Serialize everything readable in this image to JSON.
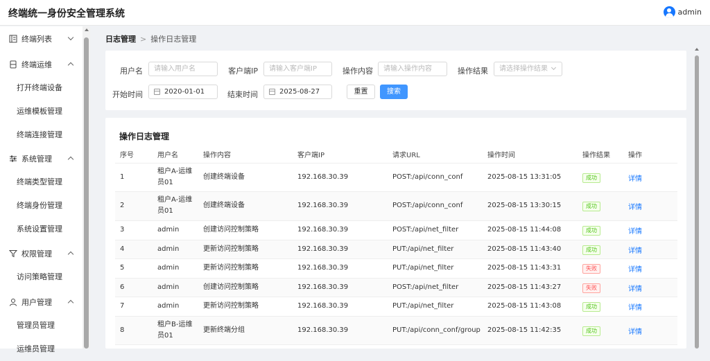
{
  "app": {
    "title": "终端统一身份安全管理系统",
    "user": "admin"
  },
  "sidebar": {
    "groups": [
      {
        "label": "终端列表",
        "icon": "list-icon",
        "expanded": false
      },
      {
        "label": "终端运维",
        "icon": "terminal-icon",
        "expanded": true,
        "items": [
          "打开终端设备",
          "运维模板管理",
          "终端连接管理"
        ]
      },
      {
        "label": "系统管理",
        "icon": "sliders-icon",
        "expanded": true,
        "items": [
          "终端类型管理",
          "终端身份管理",
          "系统设置管理"
        ]
      },
      {
        "label": "权限管理",
        "icon": "filter-icon",
        "expanded": true,
        "items": [
          "访问策略管理"
        ]
      },
      {
        "label": "用户管理",
        "icon": "user-icon",
        "expanded": true,
        "items": [
          "管理员管理",
          "运维员管理"
        ]
      }
    ]
  },
  "breadcrumb": {
    "root": "日志管理",
    "separator": ">",
    "current": "操作日志管理"
  },
  "filters": {
    "username": {
      "label": "用户名",
      "placeholder": "请输入用户名"
    },
    "client_ip": {
      "label": "客户端IP",
      "placeholder": "请输入客户端IP"
    },
    "op_content": {
      "label": "操作内容",
      "placeholder": "请输入操作内容"
    },
    "op_result": {
      "label": "操作结果",
      "placeholder": "请选择操作结果"
    },
    "start_time": {
      "label": "开始时间",
      "value": "2020-01-01"
    },
    "end_time": {
      "label": "结束时间",
      "value": "2025-08-27"
    },
    "reset_label": "重置",
    "search_label": "搜索"
  },
  "table": {
    "title": "操作日志管理",
    "columns": [
      "序号",
      "用户名",
      "操作内容",
      "客户端IP",
      "请求URL",
      "操作时间",
      "操作结果",
      "操作"
    ],
    "rows": [
      {
        "no": "1",
        "user": [
          "租户A-运维",
          "员01"
        ],
        "content": "创建终端设备",
        "ip": "192.168.30.39",
        "url": "POST:/api/conn_conf",
        "time": "2025-08-15 13:31:05",
        "result": "成功",
        "ok": true,
        "action": "详情"
      },
      {
        "no": "2",
        "user": [
          "租户A-运维",
          "员01"
        ],
        "content": "创建终端设备",
        "ip": "192.168.30.39",
        "url": "POST:/api/conn_conf",
        "time": "2025-08-15 13:30:15",
        "result": "成功",
        "ok": true,
        "action": "详情"
      },
      {
        "no": "3",
        "user": [
          "admin"
        ],
        "content": "创建访问控制策略",
        "ip": "192.168.30.39",
        "url": "POST:/api/net_filter",
        "time": "2025-08-15 11:44:08",
        "result": "成功",
        "ok": true,
        "action": "详情"
      },
      {
        "no": "4",
        "user": [
          "admin"
        ],
        "content": "更新访问控制策略",
        "ip": "192.168.30.39",
        "url": "PUT:/api/net_filter",
        "time": "2025-08-15 11:43:40",
        "result": "成功",
        "ok": true,
        "action": "详情"
      },
      {
        "no": "5",
        "user": [
          "admin"
        ],
        "content": "更新访问控制策略",
        "ip": "192.168.30.39",
        "url": "PUT:/api/net_filter",
        "time": "2025-08-15 11:43:31",
        "result": "失败",
        "ok": false,
        "action": "详情"
      },
      {
        "no": "6",
        "user": [
          "admin"
        ],
        "content": "创建访问控制策略",
        "ip": "192.168.30.39",
        "url": "POST:/api/net_filter",
        "time": "2025-08-15 11:43:27",
        "result": "失败",
        "ok": false,
        "action": "详情"
      },
      {
        "no": "7",
        "user": [
          "admin"
        ],
        "content": "更新访问控制策略",
        "ip": "192.168.30.39",
        "url": "PUT:/api/net_filter",
        "time": "2025-08-15 11:43:08",
        "result": "成功",
        "ok": true,
        "action": "详情"
      },
      {
        "no": "8",
        "user": [
          "租户B-运维",
          "员01"
        ],
        "content": "更新终端分组",
        "ip": "192.168.30.39",
        "url": "PUT:/api/conn_conf/group",
        "time": "2025-08-15 11:42:35",
        "result": "成功",
        "ok": true,
        "action": "详情"
      }
    ]
  },
  "colors": {
    "primary": "#4096ff",
    "link": "#1677ff",
    "success": "#52c41a",
    "danger": "#ff4d4f"
  }
}
